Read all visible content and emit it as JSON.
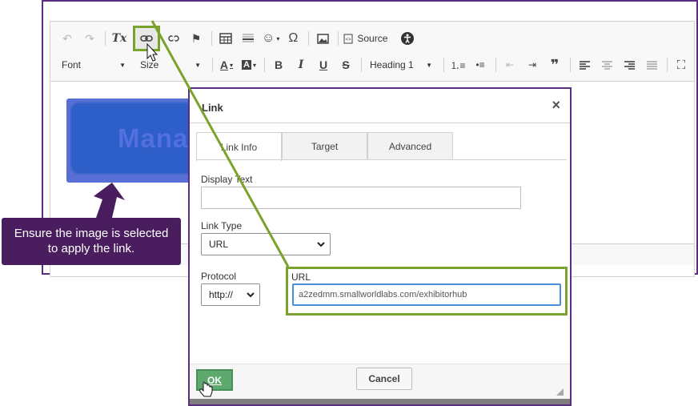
{
  "toolbar": {
    "row1": [
      {
        "name": "undo-icon",
        "glyph": "↶",
        "dim": true
      },
      {
        "name": "redo-icon",
        "glyph": "↷",
        "dim": true
      },
      {
        "name": "remove-format-icon",
        "glyph": "Tx"
      },
      {
        "name": "link-icon",
        "glyph": "🔗",
        "highlight": true
      },
      {
        "name": "unlink-icon",
        "glyph": "⛓"
      },
      {
        "name": "anchor-flag-icon",
        "glyph": "⚑"
      },
      {
        "name": "table-icon",
        "glyph": "▦"
      },
      {
        "name": "horizontal-line-icon",
        "glyph": "☰"
      },
      {
        "name": "emoji-icon",
        "glyph": "☺"
      },
      {
        "name": "omega-icon",
        "glyph": "Ω"
      },
      {
        "name": "image-icon",
        "glyph": "▣"
      }
    ],
    "source_label": "Source",
    "font_label": "Font",
    "size_label": "Size",
    "heading_label": "Heading 1",
    "bold": "B",
    "italic": "I",
    "underline": "U",
    "strike": "S",
    "quote": "❞"
  },
  "content": {
    "image_text": "Mana"
  },
  "callout": {
    "text": "Ensure the image is selected to apply the link."
  },
  "dialog": {
    "title": "Link",
    "close": "×",
    "tabs": [
      "Link Info",
      "Target",
      "Advanced"
    ],
    "display_text_label": "Display Text",
    "display_text_value": "",
    "link_type_label": "Link Type",
    "link_type_value": "URL",
    "protocol_label": "Protocol",
    "protocol_value": "http://",
    "url_label": "URL",
    "url_value": "a2zedmm.smallworldlabs.com/exhibitorhub",
    "ok_label": "OK",
    "cancel_label": "Cancel"
  },
  "colors": {
    "frame": "#5b2c83",
    "highlight": "#7aa22c",
    "ok": "#5ea96e",
    "callout": "#4a1d5e"
  }
}
